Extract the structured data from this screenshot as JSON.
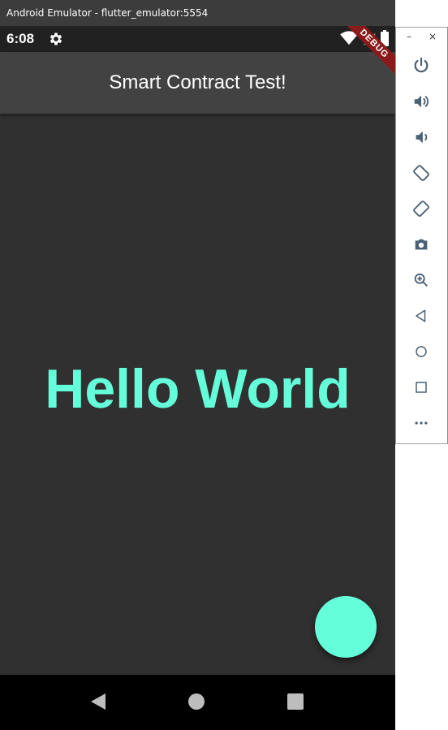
{
  "window": {
    "title": "Android Emulator - flutter_emulator:5554"
  },
  "status_bar": {
    "time": "6:08"
  },
  "app_bar": {
    "title": "Smart Contract Test!"
  },
  "debug_banner": "DEBUG",
  "body": {
    "headline": "Hello World"
  },
  "colors": {
    "accent": "#64ffda",
    "background": "#303030",
    "app_bar": "#424242",
    "status_bar": "#212121"
  },
  "toolbar": {
    "minimize": "–",
    "close": "×",
    "buttons": [
      "power-icon",
      "volume-up-icon",
      "volume-down-icon",
      "rotate-left-icon",
      "rotate-right-icon",
      "camera-icon",
      "zoom-icon",
      "back-icon",
      "home-icon",
      "overview-icon",
      "more-icon"
    ]
  }
}
